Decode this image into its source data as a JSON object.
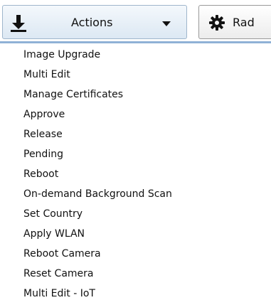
{
  "toolbar": {
    "actions_button": {
      "icon": "download-icon",
      "label": "Actions",
      "caret": "chevron-down-icon"
    },
    "radios_button": {
      "icon": "gear-icon",
      "label": "Rad"
    }
  },
  "menu": {
    "items": [
      {
        "label": "Image Upgrade"
      },
      {
        "label": "Multi Edit"
      },
      {
        "label": "Manage Certificates"
      },
      {
        "label": "Approve"
      },
      {
        "label": "Release"
      },
      {
        "label": "Pending"
      },
      {
        "label": "Reboot"
      },
      {
        "label": "On-demand Background Scan"
      },
      {
        "label": "Set Country"
      },
      {
        "label": "Apply WLAN"
      },
      {
        "label": "Reboot Camera"
      },
      {
        "label": "Reset Camera"
      },
      {
        "label": "Multi Edit - IoT"
      }
    ]
  },
  "colors": {
    "divider": "#8fb1d6",
    "actions_border": "#9fb6cc",
    "text": "#111111"
  }
}
